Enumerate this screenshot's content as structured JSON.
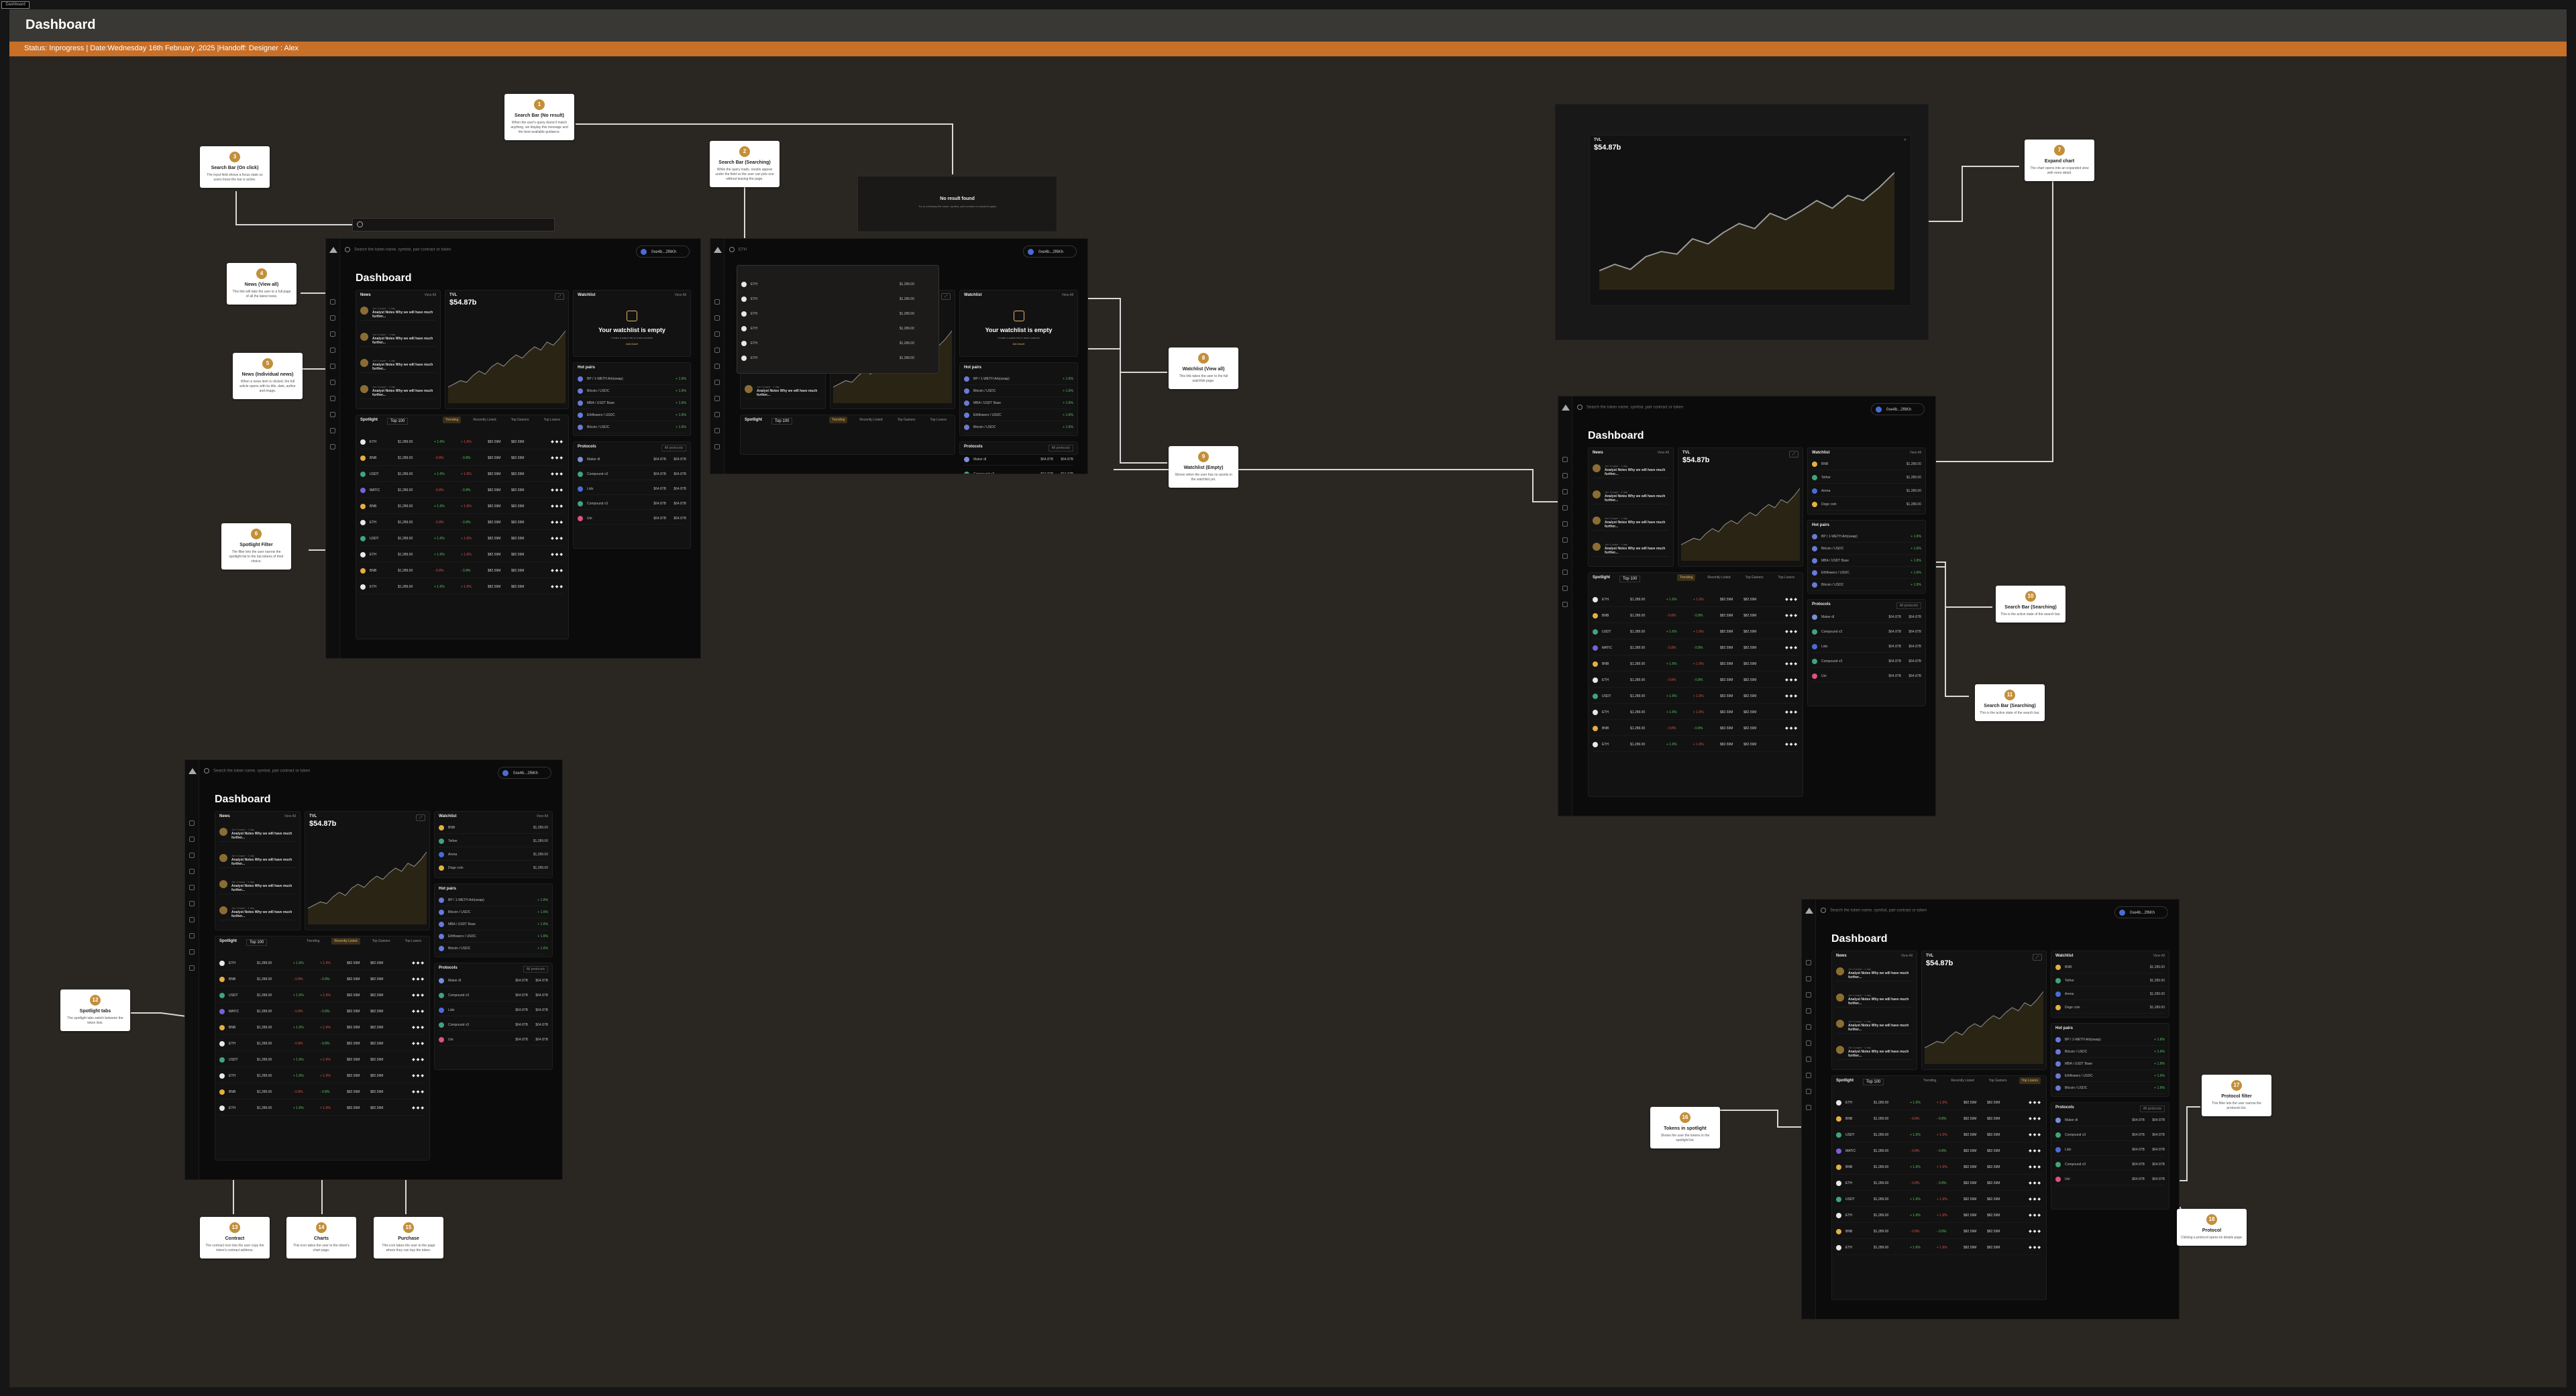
{
  "board": {
    "tag": "Dashboard",
    "title": "Dashboard",
    "status": "Status: Inprogress | Date:Wednesday 16th February ,2025 |Handoff: Designer : Alex"
  },
  "dashboard": {
    "title": "Dashboard",
    "search_placeholder": "Search the token name, symbol, pair contract or token",
    "search_value": "ETH",
    "wallet": "0xe4b...2f6Kh",
    "news_label": "News",
    "view_all": "View All",
    "news_item_meta": "Jon Cooper · 1 day",
    "news_item_title": "Analyst Notes Why we will have much further...",
    "price_label": "TVL",
    "price_value": "$54.87b",
    "price_change": "+8.4%",
    "spotlight_label": "Spotlight",
    "spotlight_filter": "Top 100",
    "tabs": [
      "Trending",
      "Recently Listed",
      "Top Gainers",
      "Top Losers"
    ],
    "watchlist_label": "Watchlist",
    "watchlist_empty_title": "Your watchlist is empty",
    "watchlist_empty_sub": "Create a watch list to track markets",
    "watchlist_add": "Add Asset",
    "hot_pairs_label": "Hot pairs",
    "protocols_label": "Protocols",
    "protocols_filter": "All protocols",
    "coins": [
      "ETH",
      "BNB",
      "USDT",
      "MATIC",
      "BNB",
      "ETH",
      "USDT",
      "ETH",
      "BNB",
      "ETH"
    ],
    "prices": [
      "$1,289.00",
      "$1,289.00",
      "$1,289.00",
      "$1,289.00",
      "$1,289.00",
      "$1,289.00",
      "$1,289.00",
      "$1,289.00",
      "$1,289.00",
      "$1,289.00"
    ],
    "changes": [
      "+ 1.6%",
      "- 0.8%",
      "+ 1.6%",
      "- 0.8%",
      "+ 1.6%",
      "- 0.8%",
      "+ 1.6%",
      "+ 1.6%",
      "- 0.8%",
      "+ 1.6%"
    ],
    "vols": [
      "$82.59M",
      "$82.59M",
      "$82.59M",
      "$82.59M",
      "$82.59M",
      "$82.59M",
      "$82.59M",
      "$82.59M",
      "$82.59M",
      "$82.59M"
    ],
    "watch_coins": [
      "BNB",
      "Tether",
      "Arena",
      "Doge coin"
    ],
    "watch_prices": [
      "$1,289.00",
      "$1,289.00",
      "$1,289.00",
      "$1,289.00"
    ],
    "pairs": [
      "BP / 1-WETH Arb(swap)",
      "Bitcoin / USDC",
      "MBA / USDT Base",
      "Ethflowers / USDC",
      "Bitcoin / USDC"
    ],
    "protocols": [
      "Maker dl",
      "Compound v3",
      "Lido",
      "Compound v3",
      "Uni"
    ],
    "proto_vals": [
      "$64.87B",
      "$64.87B",
      "$64.87B",
      "$64.87B",
      "$64.87B"
    ],
    "no_result_title": "No result found",
    "no_result_sub": "Try re-checking the name, symbol, pair contract or keyword again"
  },
  "notes": [
    {
      "n": "1",
      "title": "Search Bar (No result)",
      "text": "When the user's query doesn't match anything, we display this message and the best available guidance."
    },
    {
      "n": "2",
      "title": "Search Bar (Searching)",
      "text": "While the query loads, results appear under the field so the user can pick one without leaving the page."
    },
    {
      "n": "3",
      "title": "Search Bar (On click)",
      "text": "The input field shows a focus state so users know the bar is active."
    },
    {
      "n": "4",
      "title": "News (View all)",
      "text": "This link will take the user to a full page of all the latest news."
    },
    {
      "n": "5",
      "title": "News (Individual news)",
      "text": "When a news item is clicked, the full article opens with its title, date, author and image."
    },
    {
      "n": "6",
      "title": "Spotlight Filter",
      "text": "The filter lets the user narrow the spotlight list to the top tokens of their choice."
    },
    {
      "n": "7",
      "title": "Expand chart",
      "text": "The chart opens into an expanded view with more detail."
    },
    {
      "n": "8",
      "title": "Watchlist (View all)",
      "text": "This link takes the user to the full watchlist page."
    },
    {
      "n": "9",
      "title": "Watchlist (Empty)",
      "text": "Shown when the user has no assets in the watchlist yet."
    },
    {
      "n": "10",
      "title": "Search Bar (Searching)",
      "text": "This is the active state of the search bar."
    },
    {
      "n": "11",
      "title": "Search Bar (Searching)",
      "text": "This is the active state of the search bar."
    },
    {
      "n": "12",
      "title": "Spotlight tabs",
      "text": "The spotlight tabs switch between the token lists."
    },
    {
      "n": "13",
      "title": "Contract",
      "text": "The contract icon lets the user copy the token's contract address."
    },
    {
      "n": "14",
      "title": "Charts",
      "text": "This icon takes the user to the token's chart page."
    },
    {
      "n": "15",
      "title": "Purchase",
      "text": "This icon takes the user to the page where they can buy the token."
    },
    {
      "n": "16",
      "title": "Tokens in spotlight",
      "text": "Shows the user the tokens in the spotlight list."
    },
    {
      "n": "17",
      "title": "Protocol filter",
      "text": "This filter lets the user narrow the protocols list."
    },
    {
      "n": "18",
      "title": "Protocol",
      "text": "Clicking a protocol opens its details page."
    }
  ],
  "colors": {
    "accent": "#c38f3a",
    "status": "#c86f28",
    "pos": "#59c35f",
    "neg": "#e05050"
  }
}
